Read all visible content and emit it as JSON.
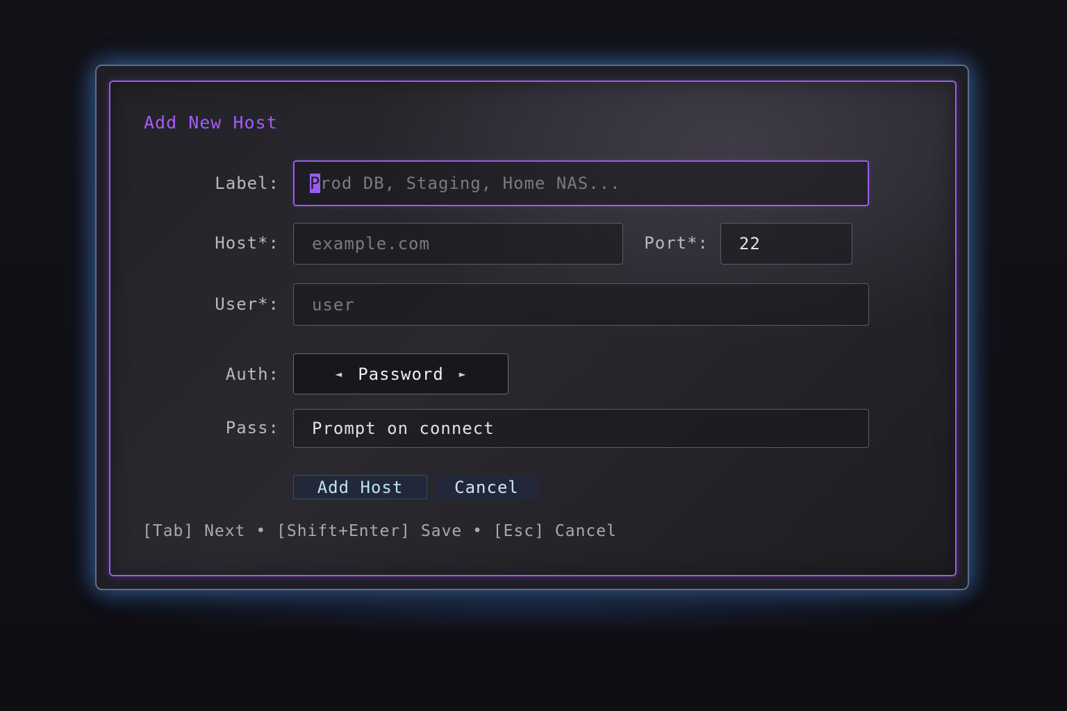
{
  "dialog": {
    "title": "Add New Host"
  },
  "form": {
    "label": {
      "label": "Label:",
      "cursor_char": "P",
      "placeholder_rest": "rod DB, Staging, Home NAS..."
    },
    "host": {
      "label": "Host*:",
      "placeholder": "example.com"
    },
    "port": {
      "label": "Port*:",
      "value": "22"
    },
    "user": {
      "label": "User*:",
      "placeholder": "user"
    },
    "auth": {
      "label": "Auth:",
      "prev_icon": "◄",
      "value": "Password",
      "next_icon": "►"
    },
    "pass": {
      "label": "Pass:",
      "value": "Prompt on connect"
    }
  },
  "buttons": {
    "add_host": "Add Host",
    "cancel": "Cancel"
  },
  "footer": {
    "hint": "[Tab] Next • [Shift+Enter] Save • [Esc] Cancel"
  },
  "colors": {
    "accent": "#9b5cf0",
    "frame_glow": "#5f9cf0"
  }
}
